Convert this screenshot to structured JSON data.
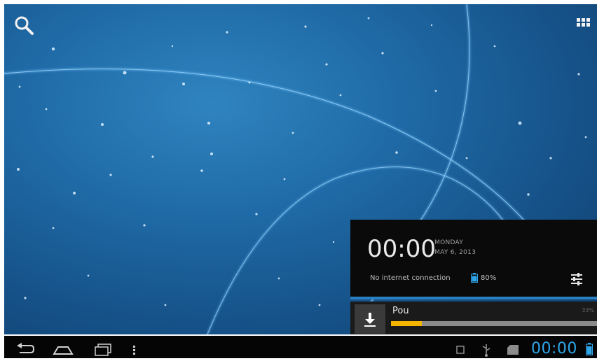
{
  "status_bar": {
    "clock": "00:00",
    "icons": [
      "screenshot-icon",
      "usb-icon",
      "sd-card-icon",
      "battery-icon"
    ]
  },
  "navigation": {
    "buttons": [
      "back-icon",
      "home-icon",
      "recent-apps-icon",
      "menu-icon"
    ]
  },
  "home_screen": {
    "top_icons": [
      "search-icon",
      "all-apps-icon"
    ]
  },
  "notification_panel": {
    "time": "00:00",
    "day": "MONDAY",
    "date": "MAY 6, 2013",
    "connection_status": "No internet connection",
    "battery": "80%",
    "notification": {
      "title": "Pou",
      "size": "33%",
      "progress": 0.15,
      "progress_color": "#f5b400"
    }
  },
  "colors": {
    "accent": "#2fa6e8",
    "wallpaper": "#1f6aa6"
  }
}
